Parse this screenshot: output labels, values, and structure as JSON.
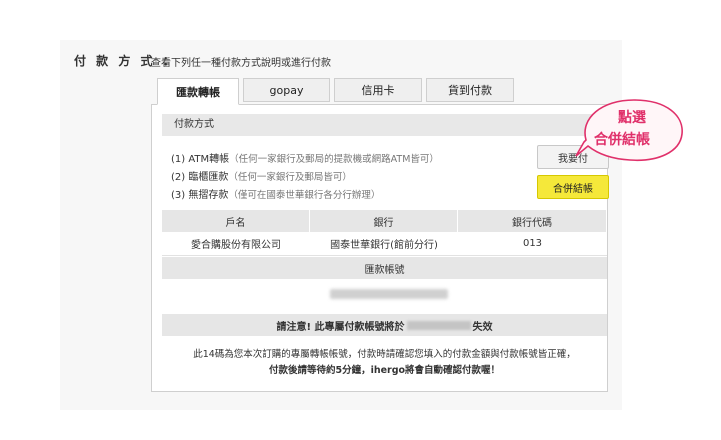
{
  "header": {
    "label": "付 款 方 式 ：",
    "description": "查看下列任一種付款方式說明或進行付款"
  },
  "tabs": [
    {
      "label": "匯款轉帳",
      "active": true
    },
    {
      "label": "gopay",
      "active": false
    },
    {
      "label": "信用卡",
      "active": false
    },
    {
      "label": "貨到付款",
      "active": false
    }
  ],
  "section": {
    "title": "付款方式",
    "methods": [
      {
        "label": "(1) ATM轉帳",
        "note": "（任何一家銀行及郵局的提款機或網路ATM皆可）"
      },
      {
        "label": "(2) 臨櫃匯款",
        "note": "（任何一家銀行及郵局皆可）"
      },
      {
        "label": "(3) 無摺存款",
        "note": "（僅可在國泰世華銀行各分行辦理）"
      }
    ],
    "buttons": {
      "copy": "我要付",
      "merge": "合併結帳"
    }
  },
  "table": {
    "headers": [
      "戶名",
      "銀行",
      "銀行代碼"
    ],
    "row": [
      "愛合購股份有限公司",
      "國泰世華銀行(館前分行)",
      "013"
    ]
  },
  "account": {
    "header": "匯款帳號"
  },
  "warning": {
    "prefix": "請注意! 此專屬付款帳號將於",
    "suffix": "失效"
  },
  "footnote": {
    "line1": "此14碼為您本次訂購的專屬轉帳帳號，付款時請確認您填入的付款金額與付款帳號皆正確，",
    "line2": "付款後請等待約5分鐘，ihergo將會自動確認付款喔！"
  },
  "sticker": {
    "line1": "點選",
    "line2": "合併結帳",
    "color": "#e0306a"
  },
  "colors": {
    "merge_button": "#f5e83a",
    "section_bg": "#e6e6e6"
  }
}
